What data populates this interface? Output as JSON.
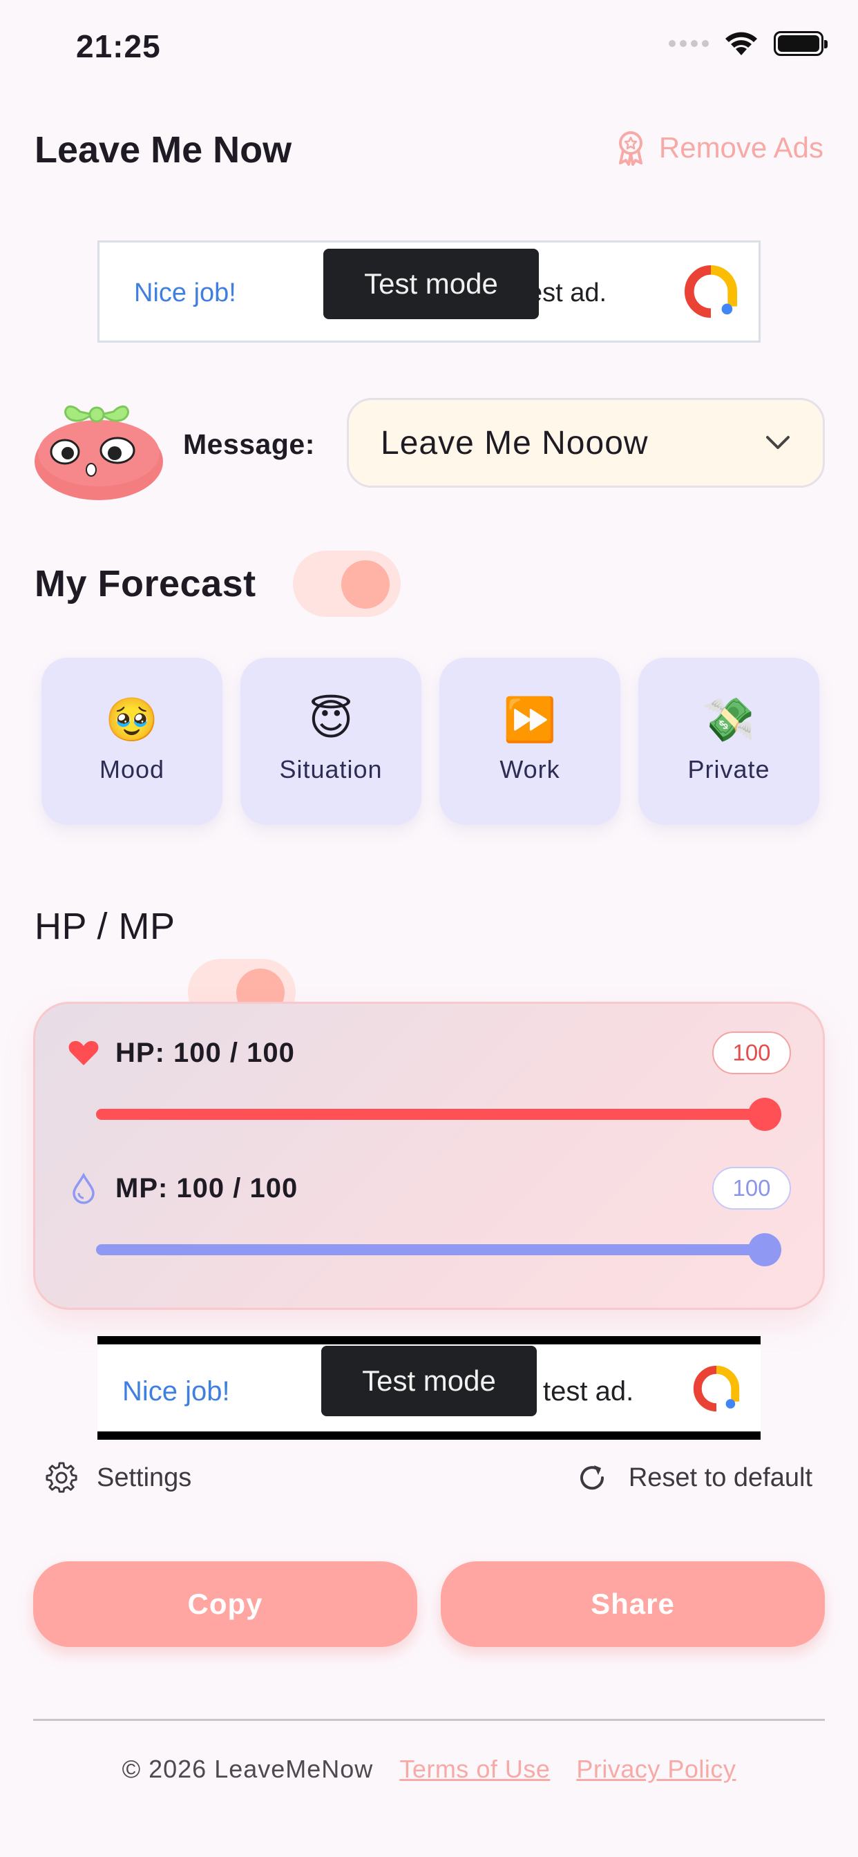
{
  "status_bar": {
    "time": "21:25"
  },
  "header": {
    "title": "Leave Me Now",
    "remove_ads_label": "Remove Ads"
  },
  "ads": {
    "top": {
      "headline": "Nice job!",
      "body_fragment": "est ad.",
      "tooltip": "Test mode"
    },
    "bottom": {
      "headline": "Nice job!",
      "body_fragment": "test ad.",
      "tooltip": "Test mode"
    }
  },
  "message": {
    "label": "Message:",
    "selected_value": "Leave Me Nooow"
  },
  "forecast": {
    "title": "My Forecast",
    "enabled": true,
    "cards": [
      {
        "emoji": "🥹",
        "label": "Mood"
      },
      {
        "emoji": "😇",
        "label": "Situation"
      },
      {
        "emoji": "⏩",
        "label": "Work"
      },
      {
        "emoji": "💸",
        "label": "Private"
      }
    ]
  },
  "hpmp": {
    "title": "HP / MP",
    "enabled": true,
    "hp": {
      "label": "HP: 100 / 100",
      "badge": "100",
      "value": 100,
      "max": 100,
      "color": "#ff5155"
    },
    "mp": {
      "label": "MP: 100 / 100",
      "badge": "100",
      "value": 100,
      "max": 100,
      "color": "#8f98f3"
    }
  },
  "settings_label": "Settings",
  "reset_label": "Reset to default",
  "actions": {
    "copy_label": "Copy",
    "share_label": "Share"
  },
  "footer": {
    "copyright": "© 2026 LeaveMeNow",
    "terms_label": "Terms of Use",
    "privacy_label": "Privacy Policy"
  },
  "colors": {
    "accent": "#ffa5a2",
    "background": "#fcf7fb",
    "card": "#e7e5fb"
  }
}
